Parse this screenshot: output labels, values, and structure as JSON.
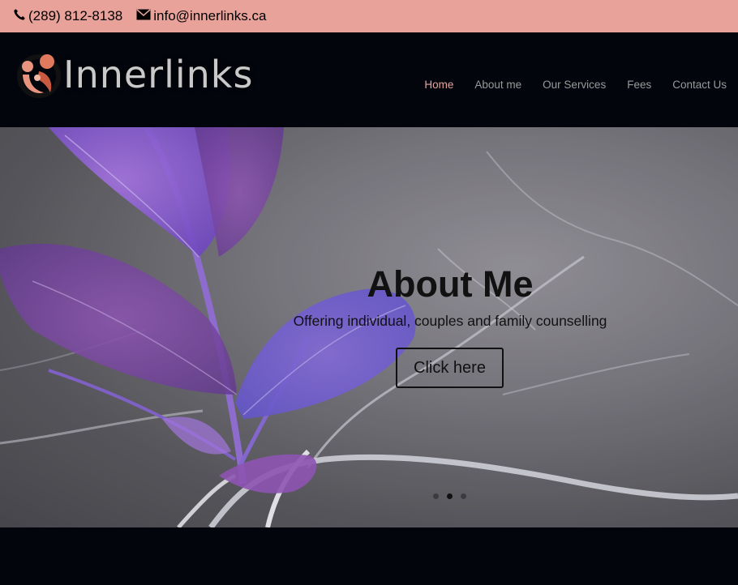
{
  "topbar": {
    "phone": "(289) 812-8138",
    "email": "info@innerlinks.ca",
    "phone_icon": "phone-icon",
    "email_icon": "envelope-icon"
  },
  "brand": {
    "name": "Innerlinks",
    "accent": "#e8a29a"
  },
  "nav": {
    "items": [
      {
        "label": "Home",
        "active": true
      },
      {
        "label": "About me",
        "active": false
      },
      {
        "label": "Our Services",
        "active": false
      },
      {
        "label": "Fees",
        "active": false
      },
      {
        "label": "Contact Us",
        "active": false
      }
    ]
  },
  "hero": {
    "title": "About Me",
    "subtitle": "Offering individual, couples and family counselling",
    "button_label": "Click here",
    "slide_count": 3,
    "active_slide": 2
  }
}
